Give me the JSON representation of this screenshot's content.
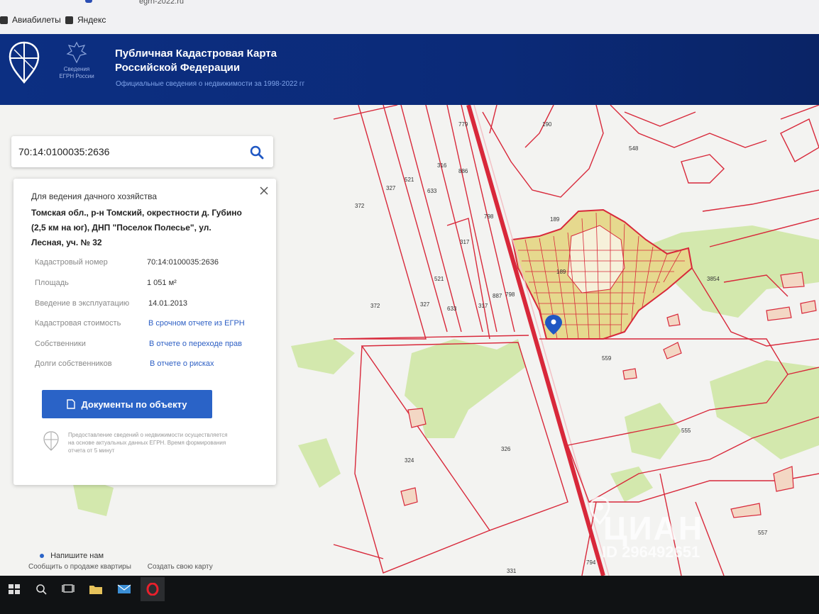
{
  "browser": {
    "url_fragment": "egrn-2022.ru",
    "bookmarks": [
      {
        "label": "Авиабилеты",
        "icon": "bookmark-icon"
      },
      {
        "label": "Яндекс",
        "icon": "bookmark-icon"
      }
    ]
  },
  "header": {
    "title_line1": "Публичная Кадастровая Карта",
    "title_line2": "Российской Федерации",
    "subtitle": "Официальные сведения о недвижимости за 1998-2022 гг",
    "logo_caption_line1": "Сведения",
    "logo_caption_line2": "ЕГРН России"
  },
  "search": {
    "value": "70:14:0100035:2636",
    "icon": "search-icon"
  },
  "info_panel": {
    "object_type": "Для ведения дачного хозяйства",
    "address": "Томская обл., р-н Томский, окрестности д. Губино (2,5 км на юг), ДНП \"Поселок Полесье\", ул. Лесная, уч. № 32",
    "properties": [
      {
        "label": "Кадастровый номер",
        "value": "70:14:0100035:2636",
        "is_link": false
      },
      {
        "label": "Площадь",
        "value": "1 051 м²",
        "is_link": false
      },
      {
        "label": "Введение в эксплуатацию",
        "value": "14.01.2013",
        "is_link": false
      },
      {
        "label": "Кадастровая стоимость",
        "value": "В срочном отчете из ЕГРН",
        "is_link": true
      },
      {
        "label": "Собственники",
        "value": "В отчете о переходе прав",
        "is_link": true
      },
      {
        "label": "Долги собственников",
        "value": "В отчете о рисках",
        "is_link": true
      }
    ],
    "docs_button": "Документы по объекту",
    "disclaimer": "Предоставление сведений о недвижимости осуществляется на основе актуальных данных ЕГРН. Время формирования отчета от 5 минут"
  },
  "map": {
    "parcel_labels": [
      "190",
      "548",
      "779",
      "372",
      "327",
      "521",
      "316",
      "633",
      "886",
      "798",
      "189",
      "317",
      "521",
      "327",
      "633",
      "317",
      "887",
      "798",
      "189",
      "372",
      "3854",
      "559",
      "324",
      "326",
      "555",
      "557",
      "331",
      "794"
    ],
    "boundary_color": "#d8283a",
    "forest_color": "#cfe5a8",
    "highlight_color": "#e8d98a"
  },
  "overlays": {
    "chat": "Напишите нам",
    "footer_left": "Сообщить о продаже квартиры",
    "footer_right": "Создать свою карту",
    "watermark_brand": "ЦИАН",
    "watermark_id": "ID 296492651"
  },
  "taskbar": {
    "items": [
      "start-icon",
      "search-icon",
      "task-view-icon",
      "file-explorer-icon",
      "mail-icon",
      "opera-icon"
    ]
  }
}
